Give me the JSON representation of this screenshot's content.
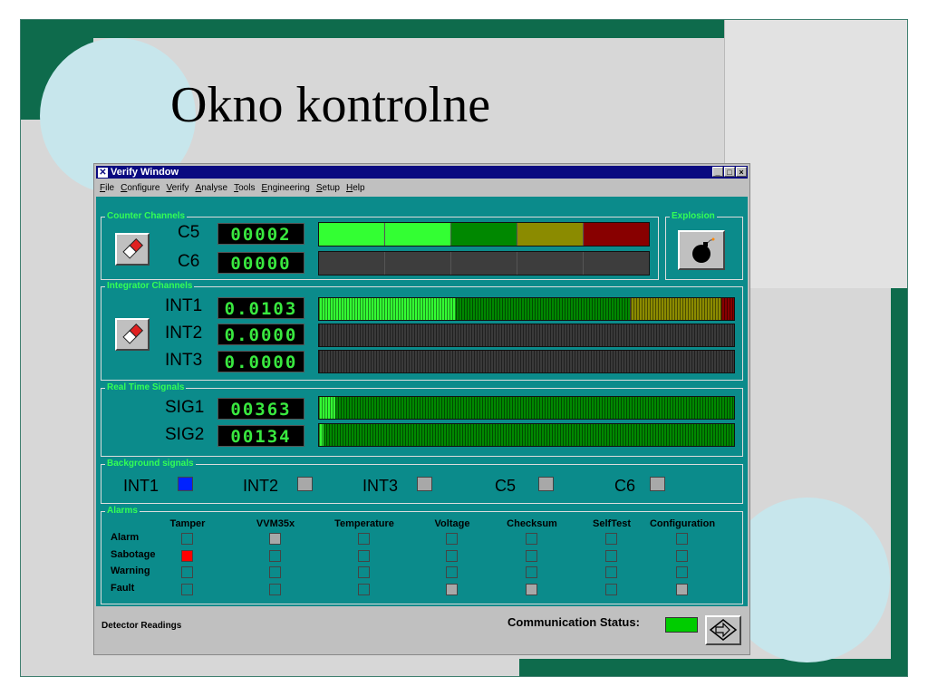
{
  "slide": {
    "title": "Okno kontrolne"
  },
  "window": {
    "title": "Verify Window",
    "controls": {
      "minimize": "_",
      "maximize": "□",
      "close": "×"
    },
    "menu": [
      "File",
      "Configure",
      "Verify",
      "Analyse",
      "Tools",
      "Engineering",
      "Setup",
      "Help"
    ]
  },
  "counter_channels": {
    "label": "Counter Channels",
    "channels": [
      {
        "name": "C5",
        "reading": "00002",
        "blocks": [
          "#33ff33",
          "#33ff33",
          "#008800",
          "#8b8b00",
          "#880000"
        ]
      },
      {
        "name": "C6",
        "reading": "00000",
        "blocks": [
          "#3d3d3d",
          "#3d3d3d",
          "#3d3d3d",
          "#3d3d3d",
          "#3d3d3d"
        ]
      }
    ]
  },
  "explosion": {
    "label": "Explosion",
    "icon": "bomb-icon"
  },
  "integrator_channels": {
    "label": "Integrator Channels",
    "channels": [
      {
        "name": "INT1",
        "reading": "0.0103",
        "levels": [
          {
            "from": 0,
            "to": 0.33,
            "color": "#33ff33"
          },
          {
            "from": 0.33,
            "to": 0.75,
            "color": "#008800"
          },
          {
            "from": 0.75,
            "to": 0.97,
            "color": "#8b8b00"
          },
          {
            "from": 0.97,
            "to": 1.0,
            "color": "#880000"
          }
        ]
      },
      {
        "name": "INT2",
        "reading": "0.0000",
        "levels": []
      },
      {
        "name": "INT3",
        "reading": "0.0000",
        "levels": []
      }
    ]
  },
  "real_time_signals": {
    "label": "Real Time Signals",
    "channels": [
      {
        "name": "SIG1",
        "reading": "00363",
        "levels": [
          {
            "from": 0,
            "to": 0.04,
            "color": "#33ff33"
          },
          {
            "from": 0.04,
            "to": 1.0,
            "color": "#008800"
          }
        ]
      },
      {
        "name": "SIG2",
        "reading": "00134",
        "levels": [
          {
            "from": 0,
            "to": 0.01,
            "color": "#33ff33"
          },
          {
            "from": 0.01,
            "to": 1.0,
            "color": "#008800"
          }
        ]
      }
    ]
  },
  "background_signals": {
    "label": "Background signals",
    "items": [
      {
        "name": "INT1",
        "active": true
      },
      {
        "name": "INT2",
        "active": false
      },
      {
        "name": "INT3",
        "active": false
      },
      {
        "name": "C5",
        "active": false
      },
      {
        "name": "C6",
        "active": false
      }
    ]
  },
  "alarms": {
    "label": "Alarms",
    "columns": [
      "Tamper",
      "VVM35x",
      "Temperature",
      "Voltage",
      "Checksum",
      "SelfTest",
      "Configuration"
    ],
    "rows": [
      "Alarm",
      "Sabotage",
      "Warning",
      "Fault"
    ],
    "states": [
      [
        "off",
        "grey",
        "off",
        "off",
        "off",
        "off",
        "off"
      ],
      [
        "red",
        "off",
        "off",
        "off",
        "off",
        "off",
        "off"
      ],
      [
        "off",
        "off",
        "off",
        "off",
        "off",
        "off",
        "off"
      ],
      [
        "off",
        "off",
        "off",
        "grey",
        "grey",
        "off",
        "grey"
      ]
    ]
  },
  "colors": {
    "panel": "#0b8b8b",
    "led_on": "#33ff33",
    "led_blue": "#0022ff",
    "led_red": "#ff0000",
    "led_grey": "#a8a8a8",
    "led_off": "#0b8b8b"
  },
  "status": {
    "left_text": "Detector Readings",
    "comm_label": "Communication Status:",
    "comm_state_color": "#00cc00"
  }
}
